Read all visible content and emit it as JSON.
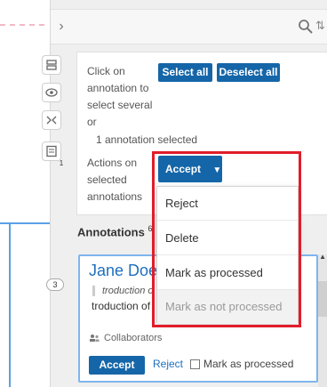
{
  "topbar": {
    "chevron": "›",
    "sort_glyph": "⇅"
  },
  "selection": {
    "hint_lines": [
      "Click on",
      "annotation to",
      "select several",
      "or"
    ],
    "count_text": "1 annotation selected",
    "select_all": "Select all",
    "deselect_all": "Deselect all",
    "actions_lines": [
      "Actions on",
      "selected",
      "annotations"
    ],
    "accept_dropdown": "Accept",
    "caret": "▼"
  },
  "dropdown": {
    "items": [
      "Reject",
      "Delete",
      "Mark as processed",
      "Mark as not processed"
    ]
  },
  "annotations": {
    "heading": "Annotations",
    "count": "6",
    "card": {
      "author": "Jane Doe",
      "quote": "troduction o",
      "text": "troduction of",
      "collaborators": "Collaborators",
      "accept": "Accept",
      "reject": "Reject",
      "mark_processed": "Mark as processed"
    }
  },
  "badges": {
    "left_count": "3",
    "top_count": "1"
  },
  "colors": {
    "accent": "#1566a8",
    "link": "#1e6fbf",
    "highlight": "#e21d2a",
    "card_border": "#7fb5ee"
  }
}
